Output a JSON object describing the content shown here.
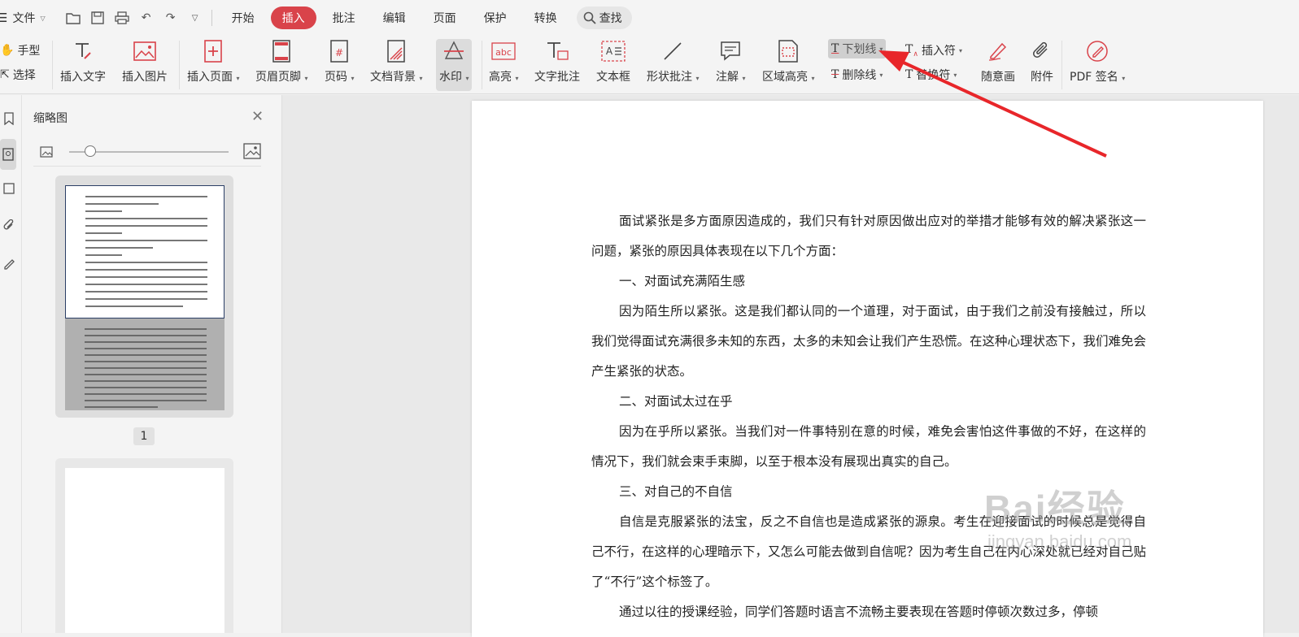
{
  "topbar": {
    "file_label": "文件",
    "tabs": [
      "开始",
      "插入",
      "批注",
      "编辑",
      "页面",
      "保护",
      "转换"
    ],
    "search_label": "查找"
  },
  "ribbon": {
    "hand_tool": "手型",
    "select_tool": "选择",
    "insert_text": "插入文字",
    "insert_image": "插入图片",
    "insert_page": "插入页面",
    "header_footer": "页眉页脚",
    "page_number": "页码",
    "doc_background": "文档背景",
    "watermark": "水印",
    "highlight": "高亮",
    "text_comment": "文字批注",
    "text_box": "文本框",
    "shape_comment": "形状批注",
    "annotation": "注解",
    "area_highlight": "区域高亮",
    "underline": "下划线",
    "strikethrough": "删除线",
    "insert_mark": "插入符",
    "replace_mark": "替换符",
    "freehand": "随意画",
    "attachment": "附件",
    "pdf_sign": "PDF 签名"
  },
  "thumbnail_panel": {
    "title": "缩略图",
    "page_label": "1"
  },
  "document": {
    "paragraphs": [
      "面试紧张是多方面原因造成的，我们只有针对原因做出应对的举措才能够有效的解决紧张这一问题，紧张的原因具体表现在以下几个方面：",
      "一、对面试充满陌生感",
      "因为陌生所以紧张。这是我们都认同的一个道理，对于面试，由于我们之前没有接触过，所以我们觉得面试充满很多未知的东西，太多的未知会让我们产生恐慌。在这种心理状态下，我们难免会产生紧张的状态。",
      "二、对面试太过在乎",
      "因为在乎所以紧张。当我们对一件事特别在意的时候，难免会害怕这件事做的不好，在这样的情况下，我们就会束手束脚，以至于根本没有展现出真实的自己。",
      "三、对自己的不自信",
      "自信是克服紧张的法宝，反之不自信也是造成紧张的源泉。考生在迎接面试的时候总是觉得自己不行，在这样的心理暗示下，又怎么可能去做到自信呢？因为考生自己在内心深处就已经对自己贴了“不行”这个标签了。",
      "通过以往的授课经验，同学们答题时语言不流畅主要表现在答题时停顿次数过多，停顿"
    ]
  },
  "watermark_overlay": {
    "brand": "Bai经验",
    "url": "jingyan.baidu.com"
  },
  "colors": {
    "accent": "#d9434a",
    "arrow": "#e8262a"
  }
}
